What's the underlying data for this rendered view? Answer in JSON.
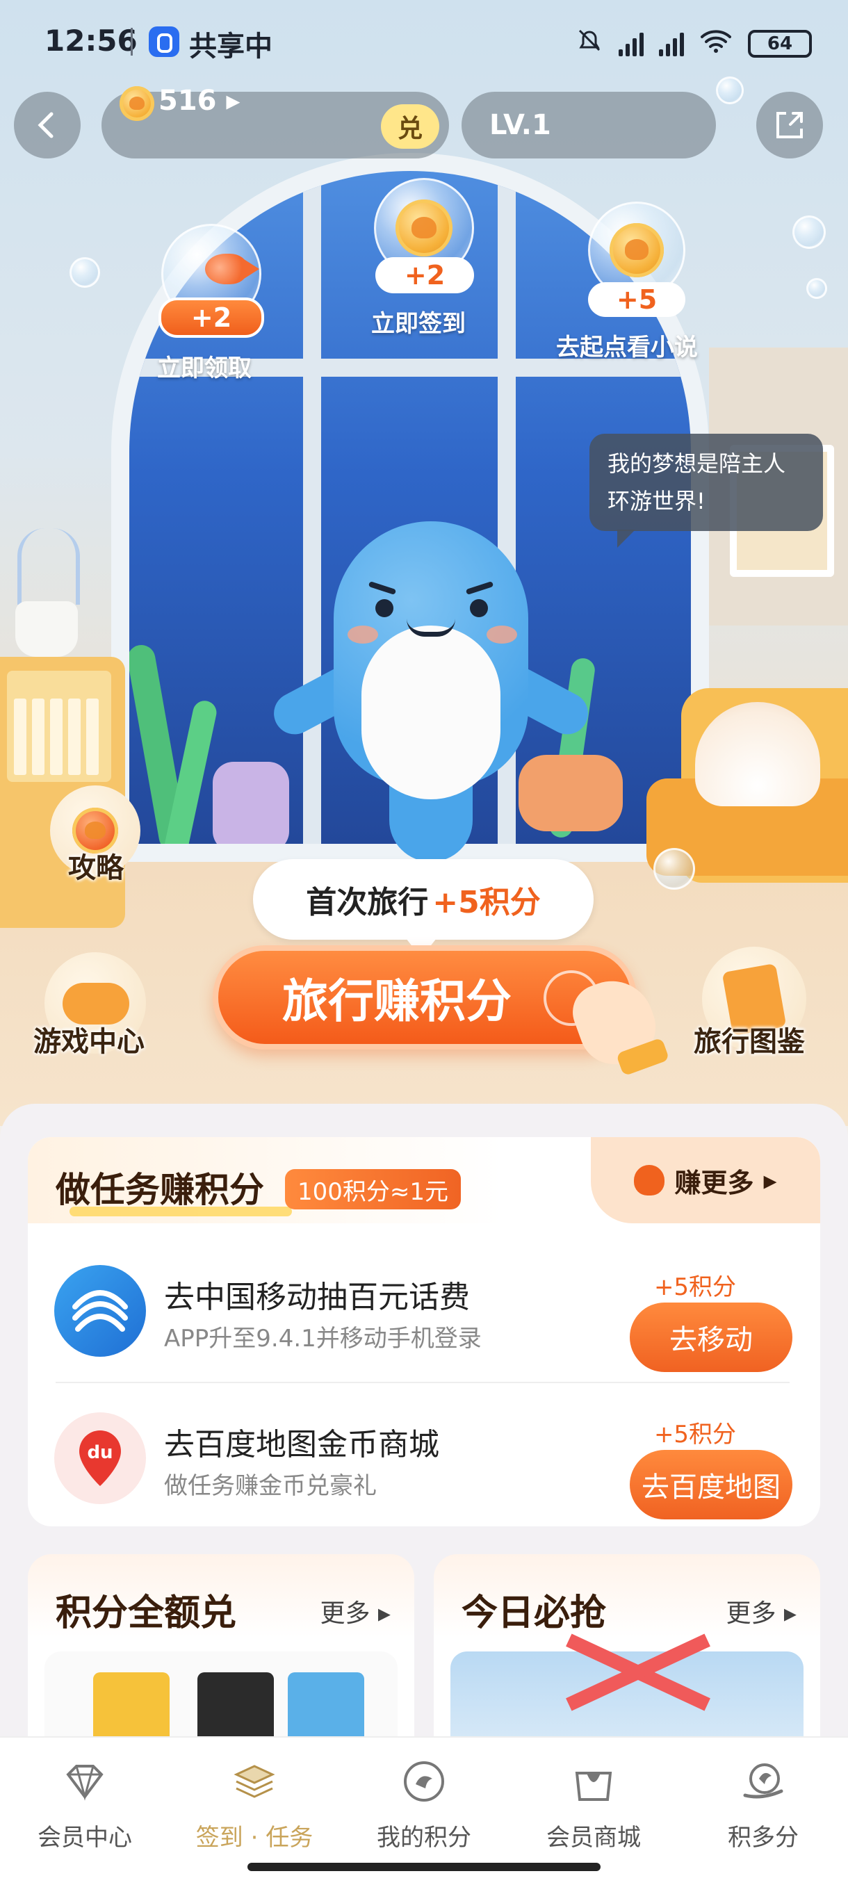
{
  "status_bar": {
    "time": "12:56",
    "share_text": "共享中",
    "battery": "64",
    "icons": [
      "bell-off-icon",
      "signal-icon",
      "signal-icon",
      "wifi-icon",
      "battery-icon"
    ]
  },
  "header": {
    "points": "516",
    "exchange_label": "兑",
    "level": "LV.1"
  },
  "rewards": [
    {
      "amount": "+2",
      "label": "立即领取"
    },
    {
      "amount": "+2",
      "label": "立即签到"
    },
    {
      "amount": "+5",
      "label": "去起点看小说"
    }
  ],
  "speech": "我的梦想是陪主人环游世界!",
  "side": {
    "guide": "攻略",
    "game_center": "游戏中心",
    "travel_book": "旅行图鉴"
  },
  "first_trip": {
    "text": "首次旅行",
    "points": "+5积分"
  },
  "travel_button": "旅行赚积分",
  "tasks": {
    "title": "做任务赚积分",
    "rate": "100积分≈1元",
    "earn_more": "赚更多",
    "items": [
      {
        "title": "去中国移动抽百元话费",
        "subtitle": "APP升至9.4.1并移动手机登录",
        "points": "+5积分",
        "button": "去移动"
      },
      {
        "title": "去百度地图金币商城",
        "subtitle": "做任务赚金币兑豪礼",
        "points": "+5积分",
        "button": "去百度地图"
      }
    ]
  },
  "promos": [
    {
      "title": "积分全额兑",
      "more": "更多"
    },
    {
      "title": "今日必抢",
      "more": "更多"
    }
  ],
  "nav": [
    {
      "label": "会员中心",
      "active": false
    },
    {
      "label": "签到 · 任务",
      "active": true
    },
    {
      "label": "我的积分",
      "active": false
    },
    {
      "label": "会员商城",
      "active": false
    },
    {
      "label": "积多分",
      "active": false
    }
  ],
  "colors": {
    "accent": "#f0621e",
    "gold": "#c9a45a",
    "blue": "#4aa5ea"
  }
}
